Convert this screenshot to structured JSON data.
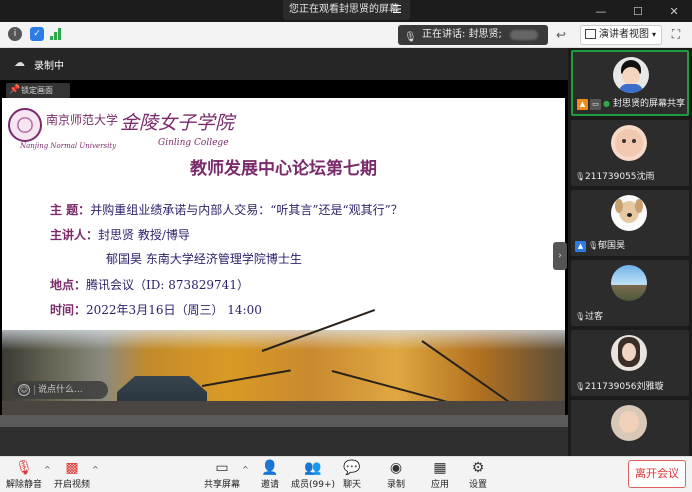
{
  "share_banner": {
    "text": "您正在观看封思贤的屏幕"
  },
  "top_toolbar": {
    "speaker_label": "正在讲话: 封思贤;",
    "view_button": "演讲者视图"
  },
  "recording": {
    "label": "录制中"
  },
  "lock_screen": {
    "label": "锁定画面"
  },
  "slide": {
    "logo_cn_1": "南京师范大学 ·",
    "logo_en_1": "Nanjing Normal University",
    "logo_cn_2": "金陵女子学院",
    "logo_en_2": "Ginling College",
    "title": "教师发展中心论坛第七期",
    "topic_key": "主  题：",
    "topic_val": "并购重组业绩承诺与内部人交易：“听其言”还是“观其行”？",
    "speaker_key": "主讲人：",
    "speaker_val": "封思贤 教授/博导",
    "co_speaker_val": "郁国昊  东南大学经济管理学院博士生",
    "place_key": "地点：",
    "place_val": "腾讯会议（ID: 873829741）",
    "time_key": "时间：",
    "time_val": "2022年3月16日（周三） 14:00"
  },
  "chat_input": {
    "placeholder": "说点什么..."
  },
  "participants": [
    {
      "name": "封思贤的屏幕共享",
      "active": true
    },
    {
      "name": "211739055沈雨"
    },
    {
      "name": "郁国昊"
    },
    {
      "name": "过客"
    },
    {
      "name": "211739056刘雅璇"
    },
    {
      "name": ""
    }
  ],
  "bottom_toolbar": {
    "mute": "解除静音",
    "video": "开启视频",
    "share": "共享屏幕",
    "invite": "邀请",
    "members": "成员(99+)",
    "chat": "聊天",
    "record": "录制",
    "apps": "应用",
    "settings": "设置",
    "leave": "离开会议"
  },
  "colors": {
    "accent_purple": "#7b2a6b",
    "leave_red": "#d33333",
    "active_green": "#1e9e3a"
  }
}
